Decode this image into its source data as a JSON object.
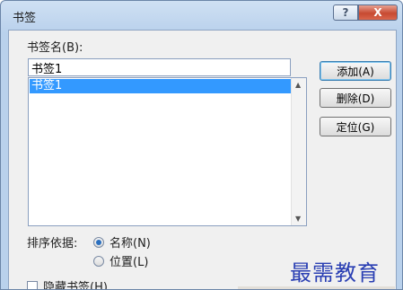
{
  "window": {
    "title": "书签",
    "help_glyph": "?",
    "close_glyph": "X"
  },
  "bookmark": {
    "name_label": "书签名(B):",
    "name_value": "书签1",
    "list_items": [
      "书签1"
    ]
  },
  "buttons": {
    "add": "添加(A)",
    "delete": "删除(D)",
    "locate": "定位(G)"
  },
  "sort": {
    "label": "排序依据:",
    "option_name": "名称(N)",
    "option_location": "位置(L)",
    "selected": "名称(N)"
  },
  "hidden": {
    "label": "隐藏书签(H)",
    "checked": false
  },
  "watermark": "最需教育"
}
